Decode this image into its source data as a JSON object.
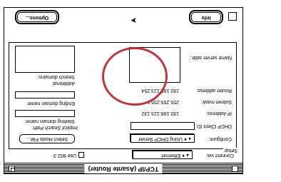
{
  "window": {
    "title": "TCP/IP (Asante Router)"
  },
  "top": {
    "connect_via_label": "Connect via:",
    "connect_via_value": "Ethernet",
    "use_8023_label": "Use 802.3"
  },
  "setup": {
    "group_label": "Setup",
    "configure_label": "Configure:",
    "configure_value": "Using DHCP Server",
    "select_hosts_button": "Select Hosts File...",
    "dhcp_client_id_label": "DHCP Client ID:",
    "dhcp_client_id_value": "",
    "ip_address_label": "IP Address:",
    "ip_address_value": "192.168.123.132",
    "subnet_mask_label": "Subnet mask:",
    "subnet_mask_value": "255.255.255.0",
    "router_address_label": "Router address:",
    "router_address_value": "192.168.123.254",
    "name_server_label": "Name server addr.:",
    "implicit_search_label": "Implicit Search Path:",
    "starting_domain_label": "Starting domain name:",
    "ending_domain_label": "Ending domain name:",
    "additional_search_label": "Additional",
    "search_domains_label": "Search domains:"
  },
  "bottom": {
    "info_button": "Info",
    "options_button": "Options..."
  },
  "colors": {
    "highlight_ring": "#c0353f"
  }
}
